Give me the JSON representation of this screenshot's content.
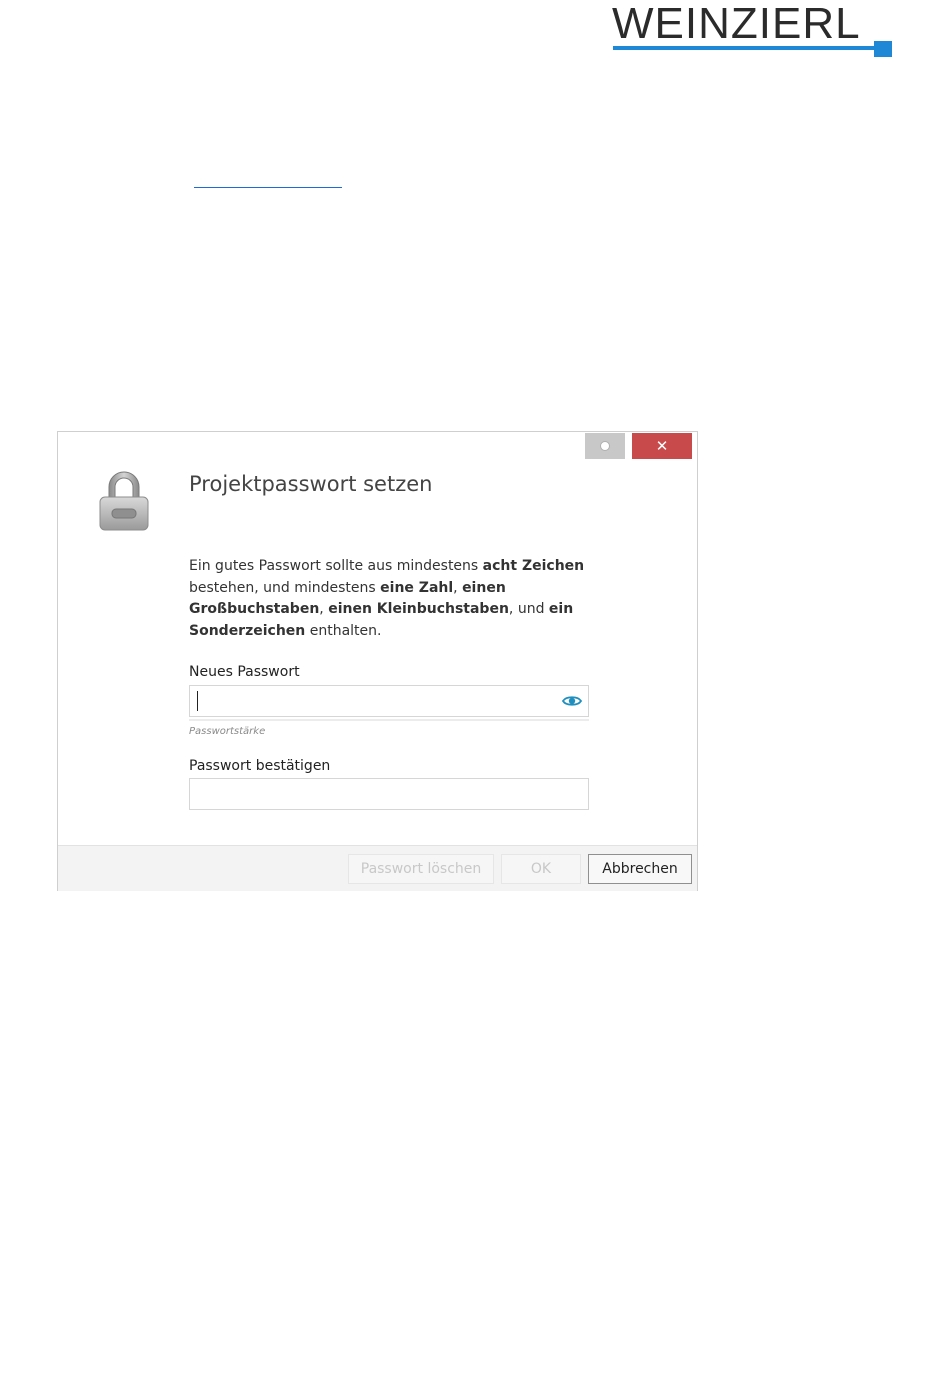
{
  "brand": {
    "logo_text": "WEINZIERL",
    "accent_color": "#1e87d6"
  },
  "dialog": {
    "title": "Projektpasswort setzen",
    "window_controls": {
      "minimize_icon": "circle-icon",
      "close_icon": "close-icon",
      "close_symbol": "✕",
      "close_color": "#c94a4a"
    },
    "lock_icon": "lock-icon",
    "description": {
      "part1": "Ein gutes Passwort sollte aus mindestens ",
      "bold1": "acht Zeichen",
      "part2": " bestehen, und mindestens ",
      "bold2": "eine Zahl",
      "part3": ", ",
      "bold3": "einen Großbuchstaben",
      "part4": ", ",
      "bold4": "einen Kleinbuchstaben",
      "part5": ", und ",
      "bold5": "ein Sonderzeichen",
      "part6": " enthalten."
    },
    "new_password": {
      "label": "Neues Passwort",
      "value": "",
      "show_icon": "eye-icon",
      "strength_label": "Passwortstärke"
    },
    "confirm_password": {
      "label": "Passwort bestätigen",
      "value": ""
    },
    "buttons": {
      "delete_label": "Passwort löschen",
      "ok_label": "OK",
      "cancel_label": "Abbrechen"
    }
  }
}
